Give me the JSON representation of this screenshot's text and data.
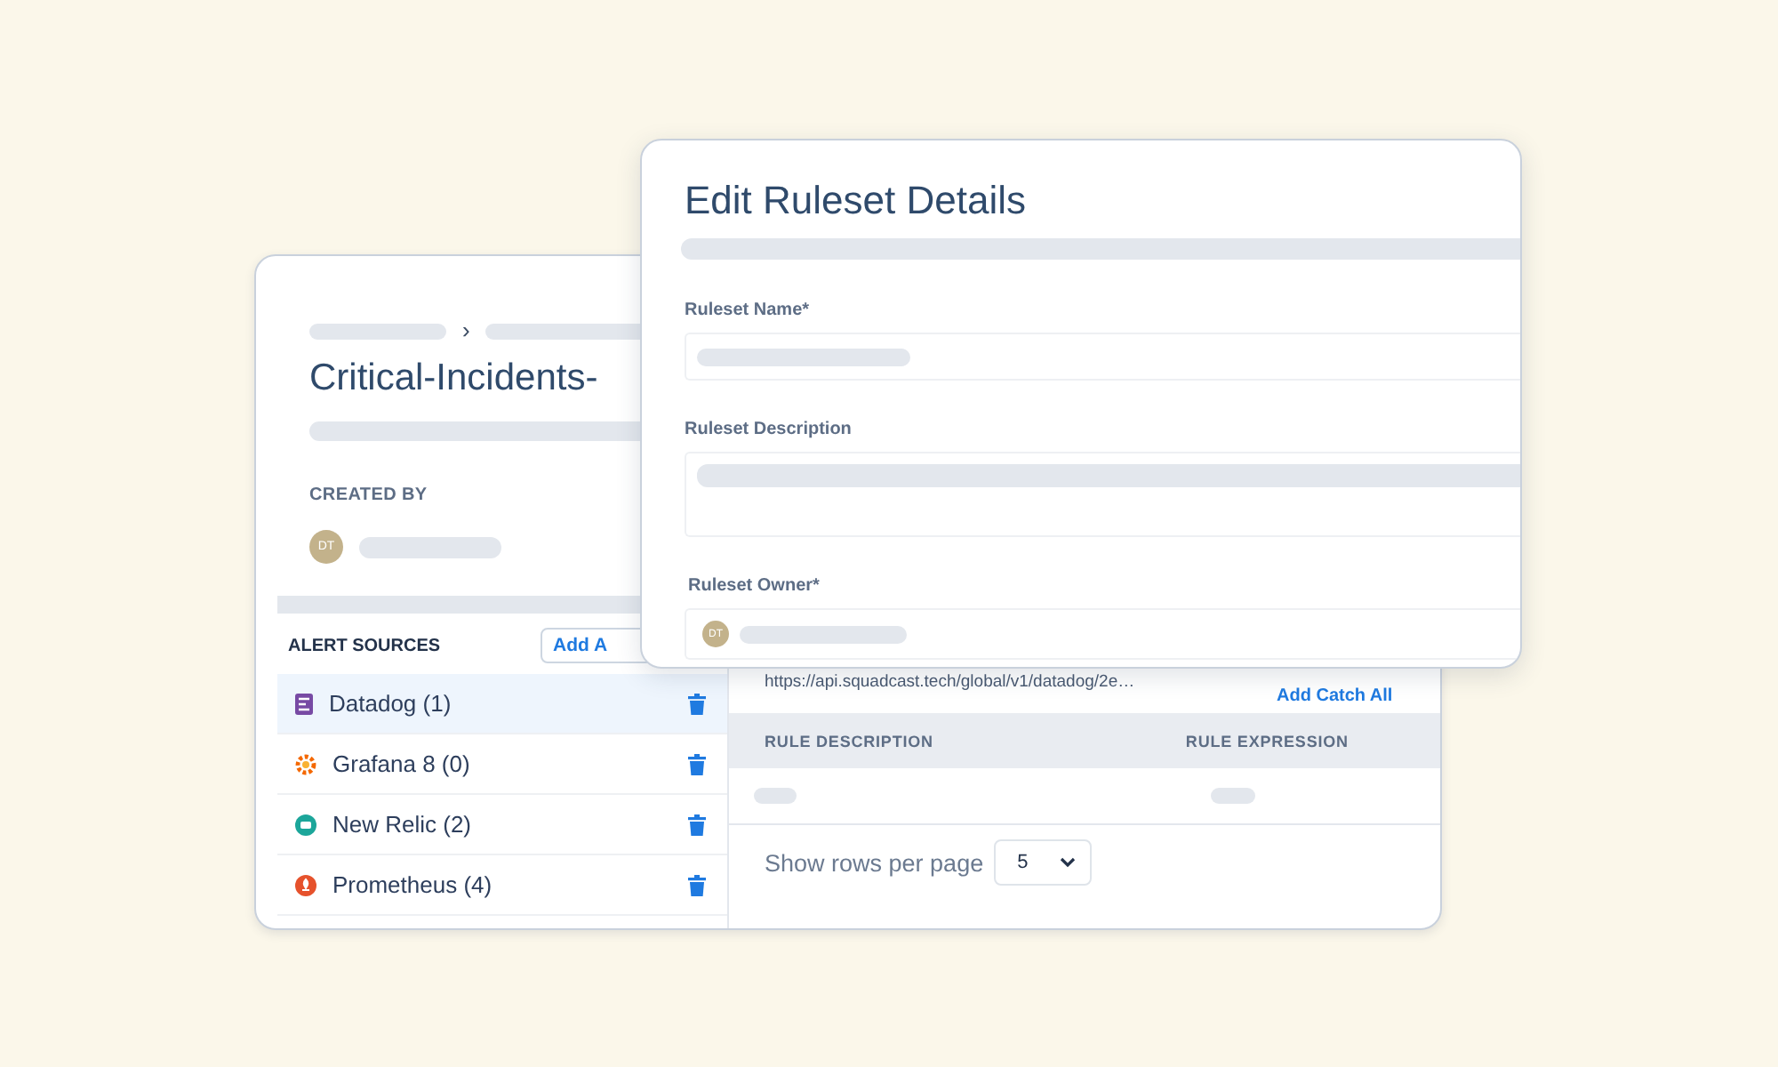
{
  "details_card": {
    "breadcrumb_separator": "›",
    "title": "Critical-Incidents-",
    "created_by_label": "CREATED BY",
    "creator_avatar": "DT",
    "alert_sources": {
      "heading": "ALERT SOURCES",
      "add_button": "Add A",
      "items": [
        {
          "name": "Datadog (1)",
          "kind": "datadog",
          "selected": true
        },
        {
          "name": "Grafana 8 (0)",
          "kind": "grafana",
          "selected": false
        },
        {
          "name": "New Relic (2)",
          "kind": "newrelic",
          "selected": false
        },
        {
          "name": "Prometheus (4)",
          "kind": "prometheus",
          "selected": false
        }
      ]
    },
    "rules": {
      "webhook_url": "https://api.squadcast.tech/global/v1/datadog/2e…",
      "add_catch_all_button": "Add Catch All",
      "columns": [
        "RULE DESCRIPTION",
        "RULE EXPRESSION"
      ],
      "rows_per_page_label": "Show rows per page",
      "rows_per_page": "5"
    }
  },
  "edit_dialog": {
    "title": "Edit Ruleset Details",
    "fields": [
      {
        "label": "Ruleset Name*",
        "kind": "text"
      },
      {
        "label": "Ruleset Description",
        "kind": "textarea"
      },
      {
        "label": "Ruleset Owner*",
        "kind": "owner",
        "avatar": "DT"
      }
    ]
  }
}
